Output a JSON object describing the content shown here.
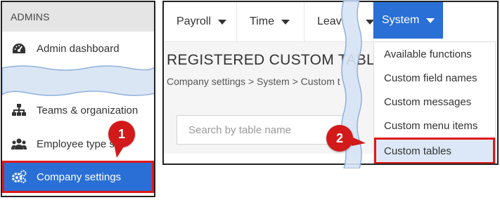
{
  "left_panel": {
    "header": "ADMINS",
    "items": [
      {
        "label": "Admin dashboard",
        "icon": "dashboard-icon"
      },
      {
        "label": "Teams & organization",
        "icon": "org-chart-icon"
      },
      {
        "label": "Employee type s",
        "icon": "people-group-icon"
      },
      {
        "label": "Company settings",
        "icon": "gears-icon"
      }
    ]
  },
  "topnav": {
    "tabs": [
      {
        "label": "Payroll"
      },
      {
        "label": "Time"
      },
      {
        "label": "Leav"
      },
      {
        "label": "System"
      }
    ]
  },
  "page": {
    "title": "REGISTERED CUSTOM TABL",
    "breadcrumb": "Company settings > System > Custom t",
    "search_placeholder": "Search by table name"
  },
  "system_menu": {
    "items": [
      {
        "label": "Available functions"
      },
      {
        "label": "Custom field names"
      },
      {
        "label": "Custom messages"
      },
      {
        "label": "Custom menu items"
      },
      {
        "label": "Custom tables"
      }
    ]
  },
  "callouts": {
    "step1": "1",
    "step2": "2"
  },
  "colors": {
    "accent_blue": "#2a6fd6",
    "highlight_red": "#e01818",
    "callout_red": "#d21a1a",
    "header_grey": "#e5e5e5",
    "menu_highlight": "#dce8f7"
  }
}
